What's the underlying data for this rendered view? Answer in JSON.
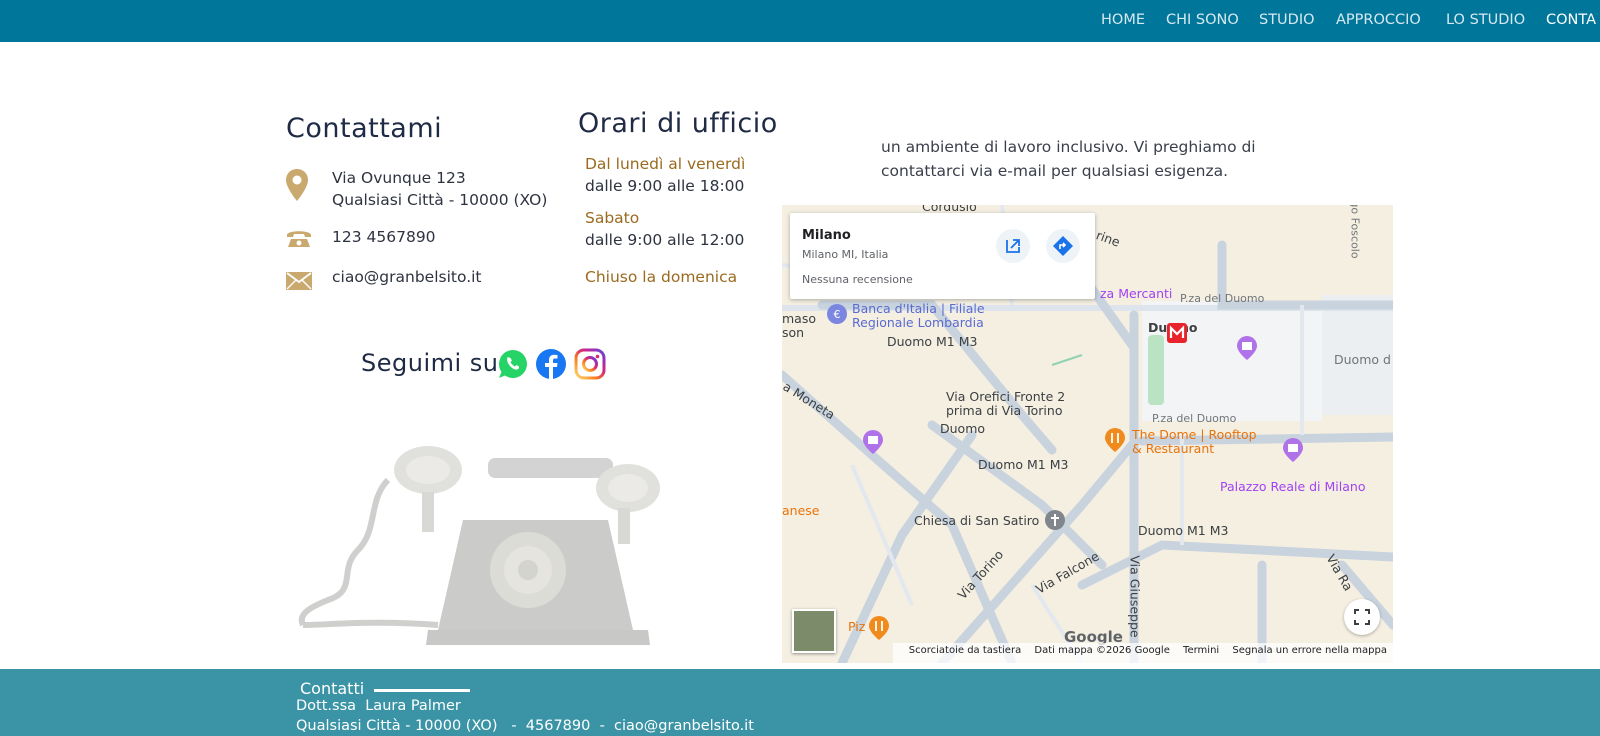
{
  "nav": {
    "items": [
      "HOME",
      "CHI SONO",
      "STUDIO",
      "APPROCCIO",
      "LO STUDIO",
      "CONTA"
    ]
  },
  "contact": {
    "title": "Contattami",
    "address_line1": "Via Ovunque 123",
    "address_line2": "Qualsiasi Città - 10000 (XO)",
    "phone": "123 4567890",
    "email": "ciao@granbelsito.it",
    "icon_color": "#c9a96e"
  },
  "hours": {
    "title": "Orari di ufficio",
    "weekday_label": "Dal lunedì al venerdì",
    "weekday_hours": "dalle 9:00 alle 18:00",
    "saturday_label": "Sabato",
    "saturday_hours": "dalle 9:00 alle 12:00",
    "sunday": "Chiuso la domenica",
    "label_color": "#9a6b1f"
  },
  "social": {
    "label": "Seguimi su",
    "icons": [
      "whatsapp-icon",
      "facebook-icon",
      "instagram-icon"
    ]
  },
  "intro": {
    "line1": "un ambiente di lavoro inclusivo. Vi preghiamo di",
    "line2": "contattarci via e-mail per qualsiasi esigenza."
  },
  "map": {
    "place_name": "Milano",
    "place_address": "Milano MI, Italia",
    "reviews": "Nessuna recensione",
    "labels": {
      "cordusio": "Cordusio",
      "mercanti": "za Mercanti",
      "pza_duomo_top": "P.za del Duomo",
      "banca": "Banca d'Italia | Filiale",
      "banca2": "Regionale Lombardia",
      "duomo_m1_1": "Duomo M1 M3",
      "duomo": "Duomo",
      "duomo_d": "Duomo d",
      "via_orefici": "Via Orefici Fronte 2",
      "via_orefici2": "prima di Via Torino",
      "duomo_2": "Duomo",
      "pza_duomo_mid": "P.za del Duomo",
      "the_dome": "The Dome | Rooftop",
      "the_dome2": "& Restaurant",
      "duomo_m1_2": "Duomo M1 M3",
      "palazzo_reale": "Palazzo Reale di Milano",
      "chiesa": "Chiesa di San Satiro",
      "duomo_m1_3": "Duomo M1 M3",
      "via_torino": "Via Torino",
      "via_falcone": "Via Falcone",
      "via_giuseppe": "Via Giuseppe",
      "via_ra": "Via Ra",
      "moneta": "a Moneta",
      "anese": "anese",
      "maso": "maso",
      "son": "son",
      "piz": "Piz",
      "foscolo": "go Foscolo",
      "rine": "rine"
    },
    "google": "Google",
    "footer": {
      "shortcuts": "Scorciatoie da tastiera",
      "data": "Dati mappa ©2026 Google",
      "terms": "Termini",
      "report": "Segnala un errore nella mappa"
    }
  },
  "footer": {
    "title": "Contatti",
    "name": "Dott.ssa  Laura Palmer",
    "info": "Qualsiasi Città - 10000 (XO)   -  4567890  -  ciao@granbelsito.it",
    "bg_color": "#3b94a6"
  }
}
